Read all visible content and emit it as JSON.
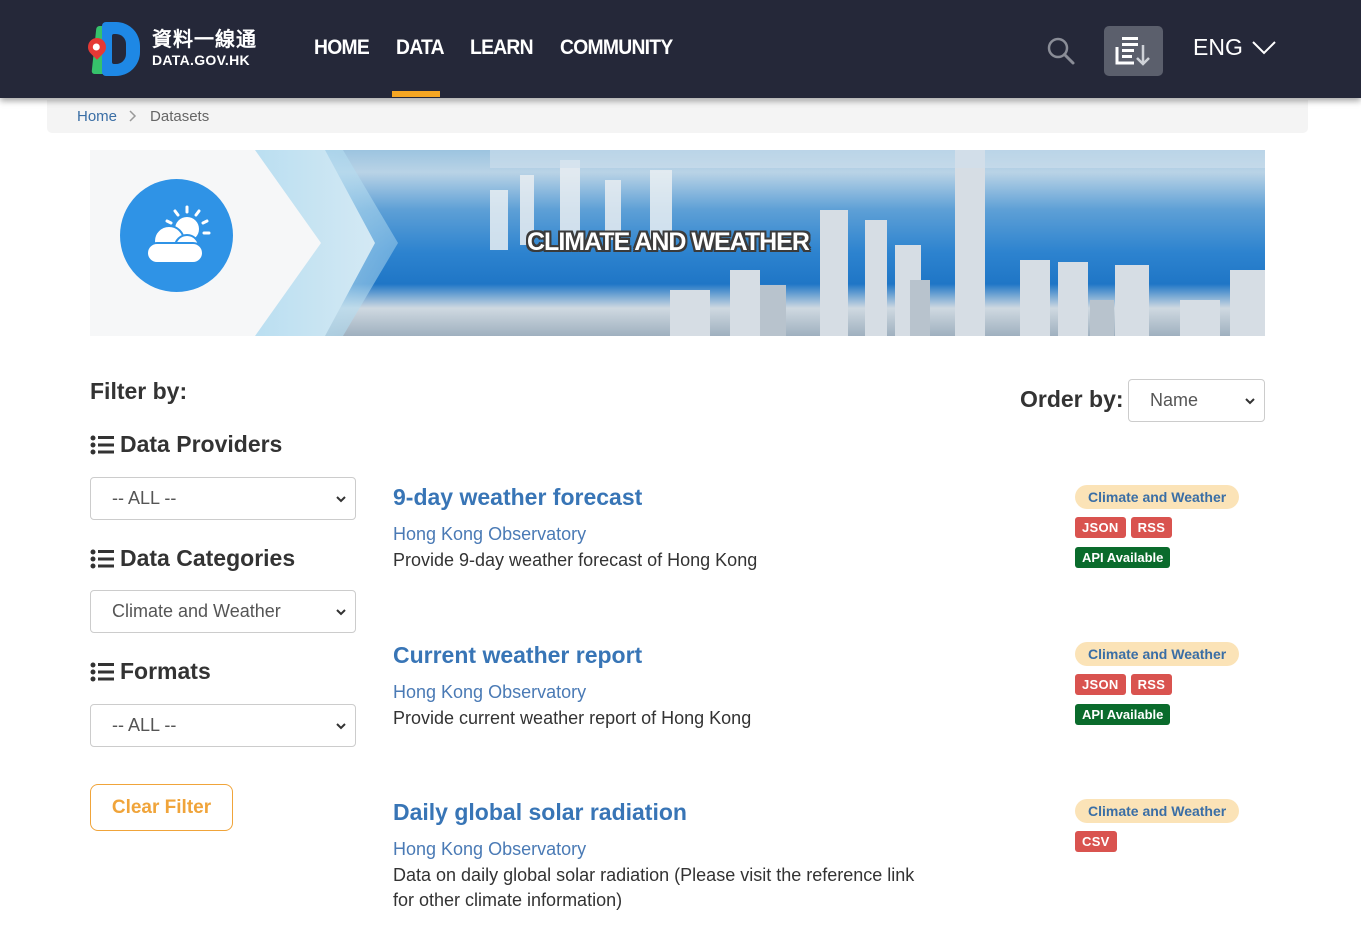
{
  "header": {
    "logo_zh": "資料一線通",
    "logo_en": "DATA.GOV.HK",
    "nav": [
      {
        "label": "HOME",
        "active": false
      },
      {
        "label": "DATA",
        "active": true
      },
      {
        "label": "LEARN",
        "active": false
      },
      {
        "label": "COMMUNITY",
        "active": false
      }
    ],
    "search_icon": "search-icon",
    "download_icon": "list-download-icon",
    "language": "ENG",
    "accent_color": "#f5a623",
    "bg_color": "#252839"
  },
  "breadcrumb": {
    "home": "Home",
    "separator": ">",
    "current": "Datasets"
  },
  "banner": {
    "title": "CLIMATE AND WEATHER",
    "icon": "cloud-sun-icon"
  },
  "filters": {
    "title": "Filter by:",
    "providers": {
      "heading": "Data Providers",
      "selected": "-- ALL --"
    },
    "categories": {
      "heading": "Data Categories",
      "selected": "Climate and Weather"
    },
    "formats": {
      "heading": "Formats",
      "selected": "-- ALL --"
    },
    "clear_label": "Clear Filter"
  },
  "order": {
    "label": "Order by:",
    "selected": "Name"
  },
  "results": [
    {
      "title": "9-day weather forecast",
      "provider": "Hong Kong Observatory",
      "description": "Provide 9-day weather forecast of Hong Kong",
      "category": "Climate and Weather",
      "formats": [
        "JSON",
        "RSS"
      ],
      "api": "API Available"
    },
    {
      "title": "Current weather report",
      "provider": "Hong Kong Observatory",
      "description": "Provide current weather report of Hong Kong",
      "category": "Climate and Weather",
      "formats": [
        "JSON",
        "RSS"
      ],
      "api": "API Available"
    },
    {
      "title": "Daily global solar radiation",
      "provider": "Hong Kong Observatory",
      "description": "Data on daily global solar radiation (Please visit the reference link for other climate information)",
      "category": "Climate and Weather",
      "formats": [
        "CSV"
      ],
      "api": null
    }
  ]
}
